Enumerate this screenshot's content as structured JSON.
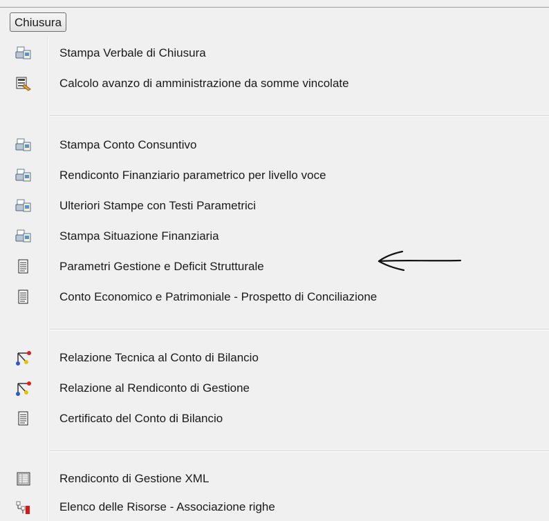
{
  "menu": {
    "title": "Chiusura"
  },
  "items": [
    {
      "label": "Stampa Verbale di Chiusura",
      "icon": "printer-icon"
    },
    {
      "label": "Calcolo avanzo di amministrazione da somme vincolate",
      "icon": "calculator-icon"
    },
    {
      "label": "Stampa Conto Consuntivo",
      "icon": "printer-icon"
    },
    {
      "label": "Rendiconto Finanziario parametrico per livello voce",
      "icon": "printer-icon"
    },
    {
      "label": "Ulteriori Stampe con Testi Parametrici",
      "icon": "printer-icon"
    },
    {
      "label": "Stampa Situazione Finanziaria",
      "icon": "printer-icon"
    },
    {
      "label": "Parametri Gestione e Deficit Strutturale",
      "icon": "document-icon"
    },
    {
      "label": "Conto Economico e Patrimoniale - Prospetto di Conciliazione",
      "icon": "document-icon"
    },
    {
      "label": "Relazione Tecnica al Conto di Bilancio",
      "icon": "diagram-icon"
    },
    {
      "label": "Relazione al Rendiconto di Gestione",
      "icon": "diagram-icon"
    },
    {
      "label": "Certificato del Conto di Bilancio",
      "icon": "document-icon"
    },
    {
      "label": "Rendiconto di Gestione XML",
      "icon": "grid-icon"
    },
    {
      "label": "Elenco delle Risorse - Associazione righe",
      "icon": "link-icon"
    }
  ]
}
